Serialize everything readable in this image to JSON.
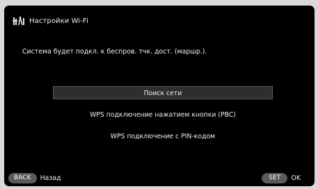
{
  "header": {
    "title": "Настройки Wi-Fi",
    "icon": "wifi-settings-icon"
  },
  "message": "Система будет подкл. к беспров. тчк. дост. (маршр.).",
  "menu": {
    "items": [
      {
        "label": "Поиск сети",
        "selected": true
      },
      {
        "label": "WPS подключение нажатием кнопки (PBC)",
        "selected": false
      },
      {
        "label": "WPS подключение с PIN-кодом",
        "selected": false
      }
    ]
  },
  "footer": {
    "back_key": "BACK",
    "back_label": "Назад",
    "set_key": "SET",
    "set_label": "OK"
  },
  "colors": {
    "background": "#000000",
    "selection": "#2e2e2e",
    "pill": "#5a5a5a",
    "text": "#f0f0f0"
  }
}
